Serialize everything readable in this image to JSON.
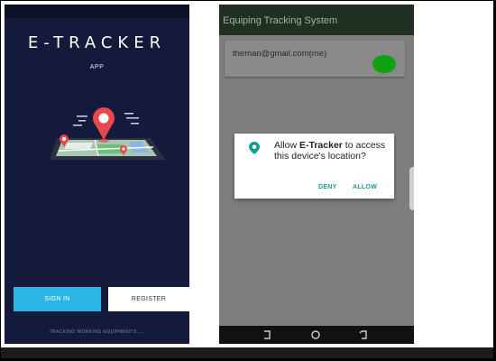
{
  "left_screen": {
    "title": "E-TRACKER",
    "subtitle": "APP",
    "signin_label": "SIGN IN",
    "register_label": "REGISTER",
    "tagline": "TRACKING WORKING EQUIPMENTS ....",
    "colors": {
      "background": "#141a3b",
      "signin": "#29b6e6",
      "pin": "#e8474c"
    }
  },
  "right_screen": {
    "app_title": "Equiping Tracking System",
    "account_email": "theman@gmail.com(me)",
    "status_color": "#0fa10f",
    "dialog": {
      "icon": "location-pin-icon",
      "text_pre": "Allow ",
      "app_name": "E-Tracker",
      "text_post": " to access this device's location?",
      "deny_label": "DENY",
      "allow_label": "ALLOW",
      "accent": "#159c8e"
    },
    "nav_icons": [
      "back-icon",
      "home-icon",
      "recent-apps-icon"
    ]
  }
}
